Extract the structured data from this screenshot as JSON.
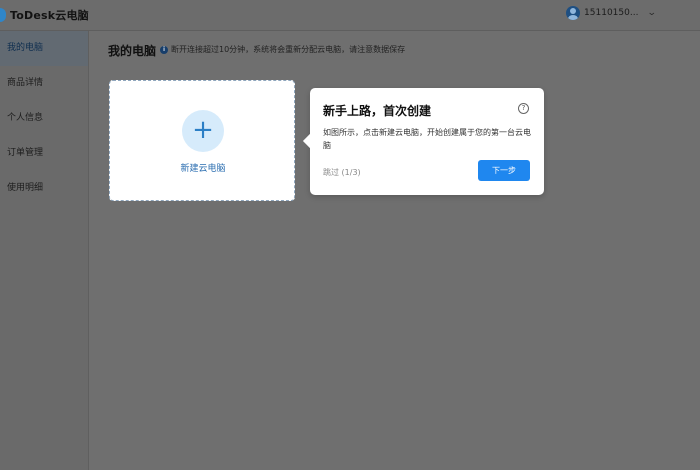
{
  "app": {
    "logo_text": "ToDesk云电脑"
  },
  "user": {
    "id": "15110150..."
  },
  "sidebar": {
    "items": [
      {
        "label": "我的电脑"
      },
      {
        "label": "商品详情"
      },
      {
        "label": "个人信息"
      },
      {
        "label": "订单管理"
      },
      {
        "label": "使用明细"
      }
    ]
  },
  "main": {
    "title": "我的电脑",
    "notice": "断开连接超过10分钟，系统将会重新分配云电脑，请注意数据保存",
    "new_computer_label": "新建云电脑"
  },
  "guide": {
    "title": "新手上路，首次创建",
    "body": "如图所示，点击新建云电脑，开始创建属于您的第一台云电脑",
    "skip_label": "跳过 (1/3)",
    "next_label": "下一步"
  },
  "colors": {
    "accent": "#1f87ef",
    "overlay": "#6f6f6f",
    "plus_bg": "#d6ebfb"
  }
}
